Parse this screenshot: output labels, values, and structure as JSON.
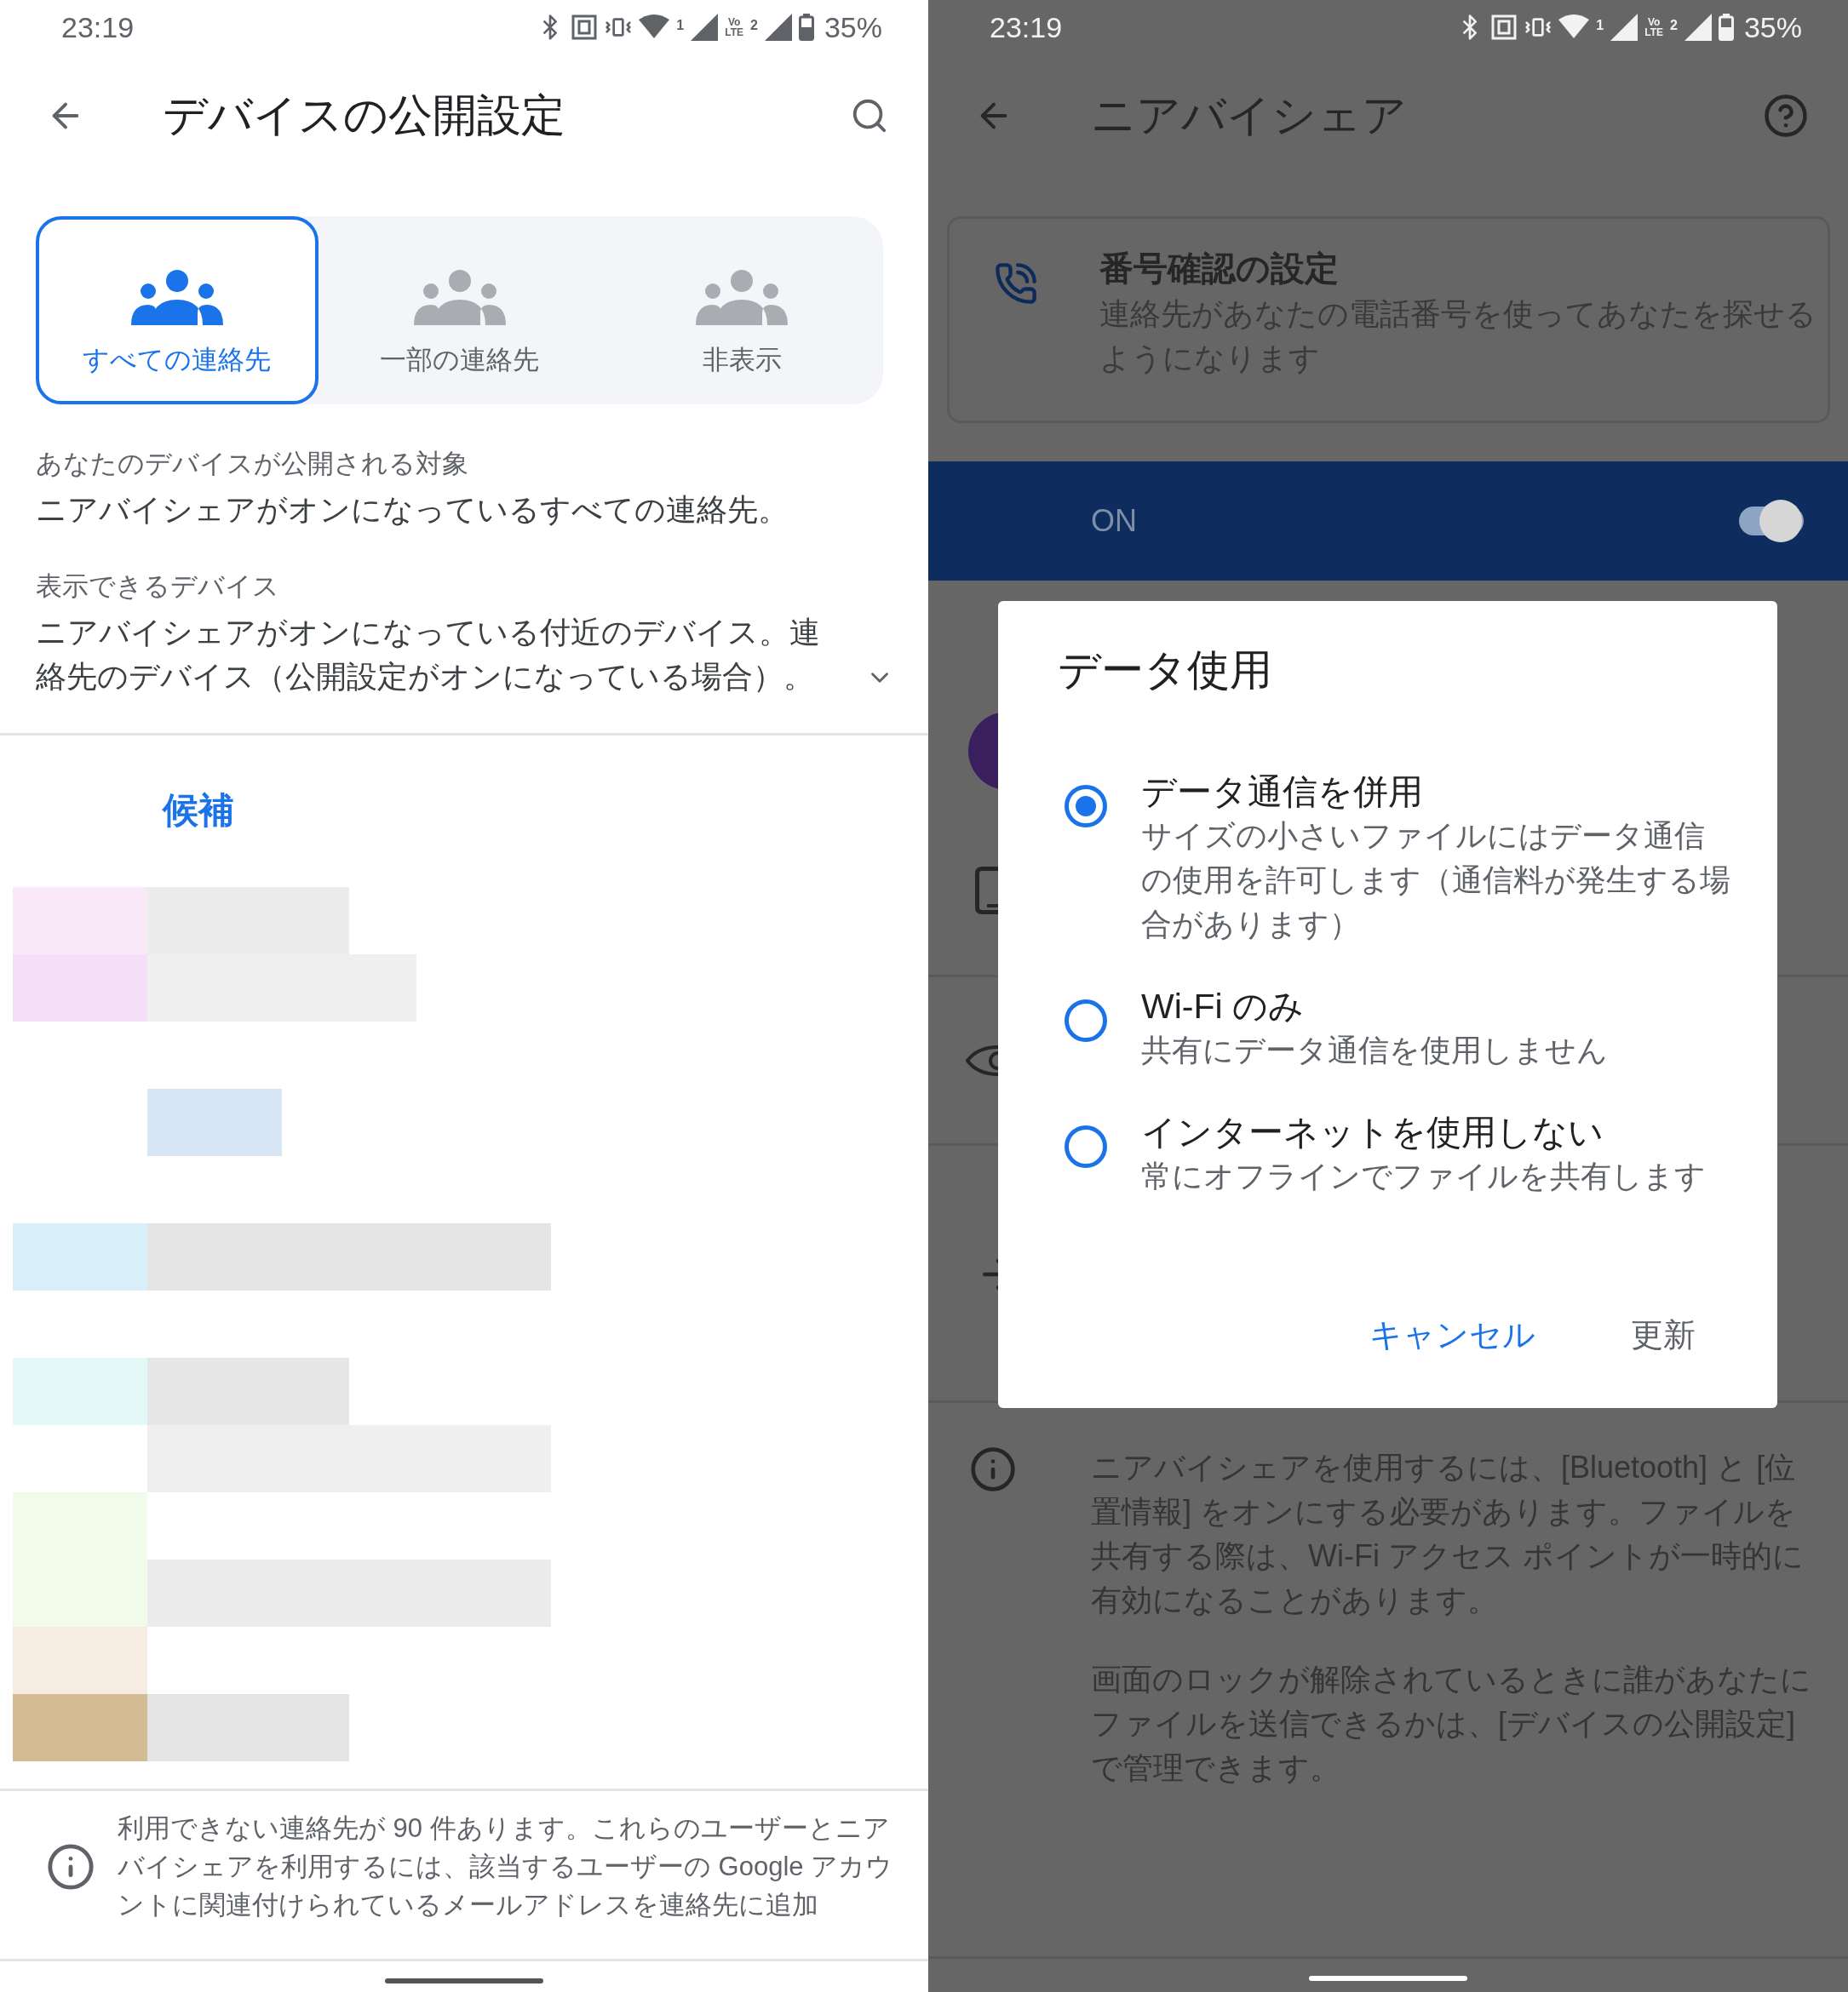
{
  "left": {
    "status_bar": {
      "time": "23:19",
      "wifi_badge": "1",
      "volte_top": "Vo",
      "volte_bottom": "LTE",
      "sim_badge": "2",
      "battery": "35%"
    },
    "app_bar": {
      "title": "デバイスの公開設定"
    },
    "visibility_options": [
      {
        "label": "すべての連絡先",
        "selected": true
      },
      {
        "label": "一部の連絡先",
        "selected": false
      },
      {
        "label": "非表示",
        "selected": false
      }
    ],
    "sections": [
      {
        "label": "あなたのデバイスが公開される対象",
        "value": "ニアバイシェアがオンになっているすべての連絡先。",
        "expandable": false
      },
      {
        "label": "表示できるデバイス",
        "value": "ニアバイシェアがオンになっている付近のデバイス。連絡先のデバイス（公開設定がオンになっている場合）。",
        "expandable": true
      }
    ],
    "suggestions": {
      "heading": "候補"
    },
    "info_note": "利用できない連絡先が 90 件あります。これらのユーザーとニアバイシェアを利用するには、該当するユーザーの Google アカウントに関連付けられているメールアドレスを連絡先に追加"
  },
  "right": {
    "status_bar": {
      "time": "23:19",
      "wifi_badge": "1",
      "volte_top": "Vo",
      "volte_bottom": "LTE",
      "sim_badge": "2",
      "battery": "35%"
    },
    "app_bar": {
      "title": "ニアバイシェア"
    },
    "number_card": {
      "title": "番号確認の設定",
      "subtitle": "連絡先があなたの電話番号を使ってあなたを探せるようになります"
    },
    "main_switch": {
      "label": "ON",
      "on": true
    },
    "info_paragraphs": [
      "ニアバイシェアを使用するには、[Bluetooth] と [位置情報] をオンにする必要があります。ファイルを共有する際は、Wi-Fi アクセス ポイントが一時的に有効になることがあります。",
      "画面のロックが解除されているときに誰があなたにファイルを送信できるかは、[デバイスの公開設定] で管理できます。"
    ],
    "dialog": {
      "title": "データ使用",
      "options": [
        {
          "title": "データ通信を併用",
          "subtitle": "サイズの小さいファイルにはデータ通信の使用を許可します（通信料が発生する場合があります）",
          "selected": true
        },
        {
          "title": "Wi-Fi のみ",
          "subtitle": "共有にデータ通信を使用しません",
          "selected": false
        },
        {
          "title": "インターネットを使用しない",
          "subtitle": "常にオフラインでファイルを共有します",
          "selected": false
        }
      ],
      "buttons": [
        {
          "label": "キャンセル",
          "disabled": false
        },
        {
          "label": "更新",
          "disabled": true
        }
      ]
    }
  }
}
